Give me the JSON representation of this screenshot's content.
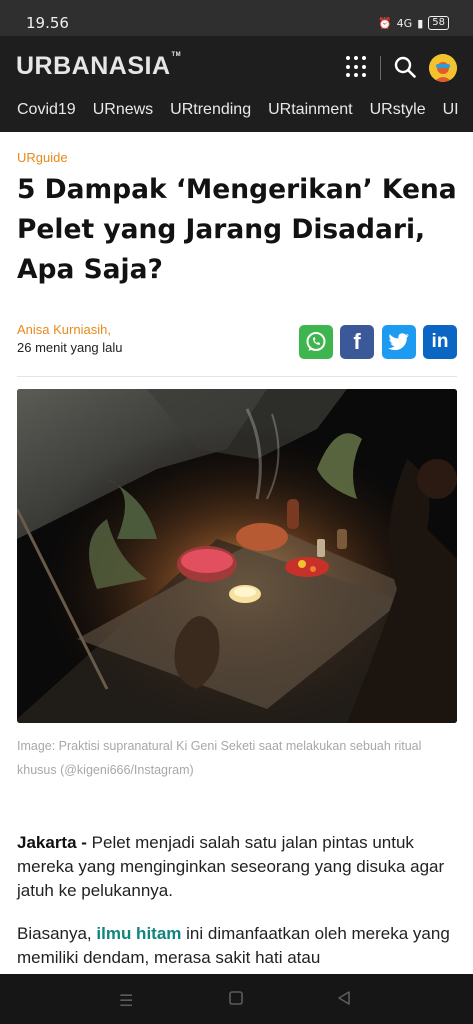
{
  "status": {
    "time": "19.56",
    "network": "4G",
    "battery": "58"
  },
  "header": {
    "logo": "URBANASIA",
    "logo_tm": "TM",
    "nav_tabs": [
      "Covid19",
      "URnews",
      "URtrending",
      "URtainment",
      "URstyle",
      "UI"
    ]
  },
  "article": {
    "category": "URguide",
    "title": "5 Dampak ‘Mengerikan’ Kena Pelet yang Jarang Disadari, Apa Saja?",
    "author": "Anisa Kurniasih,",
    "published": "26 menit yang lalu",
    "share": {
      "whatsapp": "whatsapp",
      "facebook": "f",
      "twitter": "twitter",
      "linkedin": "in"
    },
    "caption": "Image: Praktisi supranatural Ki Geni Seketi saat melakukan sebuah ritual khusus (@kigeni666/Instagram)",
    "p1_lead": "Jakarta -",
    "p1_text": " Pelet menjadi salah satu jalan pintas untuk mereka yang menginginkan seseorang yang disuka agar jatuh ke pelukannya.",
    "p2_before": "Biasanya, ",
    "p2_link": "ilmu hitam",
    "p2_after": " ini dimanfaatkan oleh mereka yang  memiliki dendam, merasa sakit hati atau"
  },
  "colors": {
    "accent": "#e88a1a",
    "link": "#10857f",
    "header_bg": "#1e1e1e"
  },
  "icons": [
    "grid-menu-icon",
    "search-icon",
    "avatar",
    "menu-icon",
    "home-icon",
    "back-icon"
  ]
}
